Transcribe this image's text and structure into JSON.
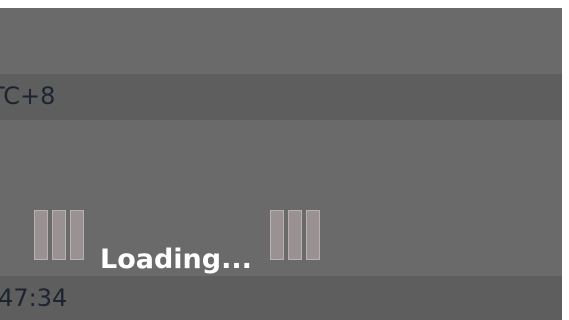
{
  "timezone_text": "TC+8",
  "time_text": ":47:34",
  "loading": {
    "label": "Loading..."
  },
  "colors": {
    "overlay": "#6a6a6a",
    "band": "#5e5e5e",
    "band_text": "#1c2430",
    "spinner_bar": "#9a9193",
    "loading_text": "#ffffff"
  }
}
